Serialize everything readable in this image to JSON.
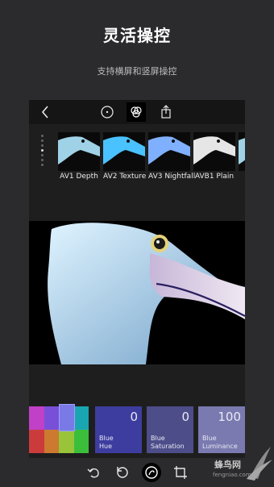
{
  "headline": "灵活操控",
  "subline": "支持横屏和竖屏操控",
  "toolbar": {
    "icons": [
      "back-icon",
      "info-icon",
      "filter-circles-icon",
      "share-icon"
    ]
  },
  "filters": [
    {
      "label": "AV1 Depth",
      "tint": "#9fd2e6"
    },
    {
      "label": "AV2 Texture",
      "tint": "#49c2ff"
    },
    {
      "label": "AV3 Nightfall",
      "tint": "#7fb0ff"
    },
    {
      "label": "AVB1 Plain",
      "tint": "#e6e6e6"
    },
    {
      "label": "A",
      "tint": "#9fd2e6"
    }
  ],
  "adjust": {
    "swatches": [
      "#c040c8",
      "#7a4fd8",
      "#6f86e8",
      "#1aa6b0",
      "#cc3b3b",
      "#cc7a2f",
      "#99c43a",
      "#3bbf3b"
    ],
    "tiles": [
      {
        "value": "0",
        "line1": "Blue",
        "line2": "Hue",
        "color": "#3d3da0"
      },
      {
        "value": "0",
        "line1": "Blue",
        "line2": "Saturation",
        "color": "#4d4d8a"
      },
      {
        "value": "100",
        "line1": "Blue",
        "line2": "Luminance",
        "color": "#7a7ab0"
      }
    ]
  },
  "bottombar": {
    "icons": [
      "undo-icon",
      "reset-icon",
      "filters-icon",
      "crop-icon"
    ]
  },
  "watermark": {
    "name": "蜂鸟网",
    "url": "fengniao.com"
  }
}
